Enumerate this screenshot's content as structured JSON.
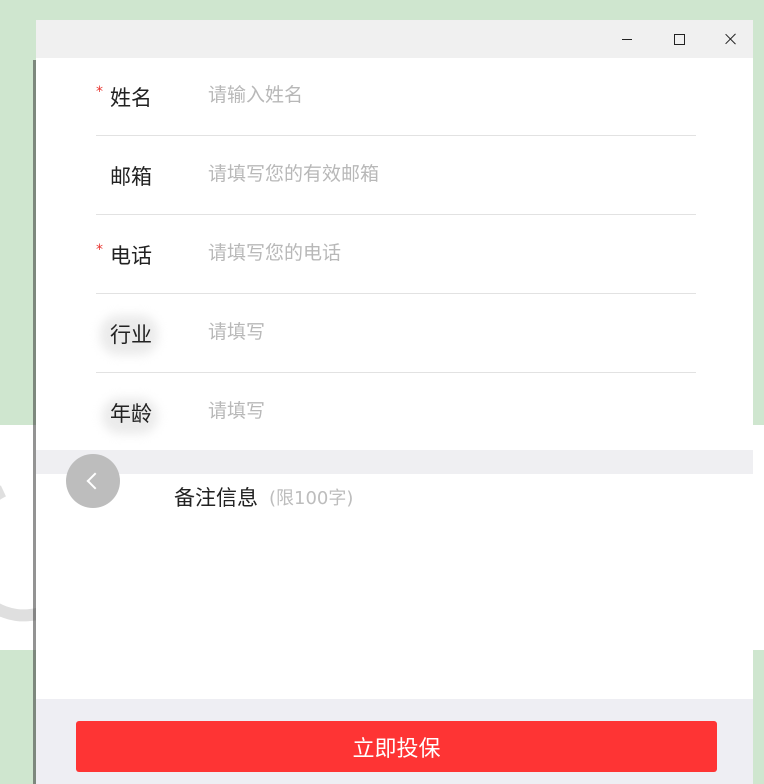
{
  "window": {
    "minimize_label": "–",
    "maximize_label": "□",
    "close_label": "×"
  },
  "form": {
    "required_mark": "*",
    "fields": [
      {
        "label": "姓名",
        "placeholder": "请输入姓名",
        "required": true,
        "value": ""
      },
      {
        "label": "邮箱",
        "placeholder": "请填写您的有效邮箱",
        "required": false,
        "value": ""
      },
      {
        "label": "电话",
        "placeholder": "请填写您的电话",
        "required": true,
        "value": ""
      },
      {
        "label": "行业",
        "placeholder": "请填写",
        "required": false,
        "value": ""
      },
      {
        "label": "年龄",
        "placeholder": "请填写",
        "required": false,
        "value": ""
      }
    ]
  },
  "notes": {
    "label": "备注信息",
    "hint": "(限100字)",
    "value": ""
  },
  "submit": {
    "label": "立即投保"
  },
  "colors": {
    "accent": "#fe3434",
    "required": "#e8332e",
    "placeholder": "#b8b8b8",
    "footer_bg": "#eeeef3",
    "page_bg": "#cfe6cf"
  },
  "icons": {
    "back": "chevron-left-icon",
    "close": "close-icon",
    "minimize": "minimize-icon",
    "maximize": "maximize-icon"
  }
}
